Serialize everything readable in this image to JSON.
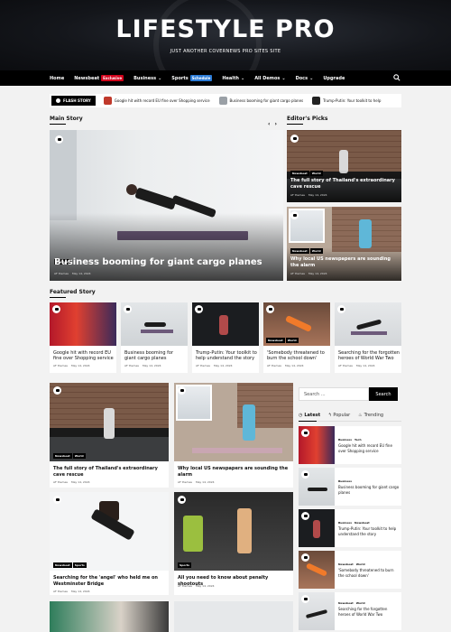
{
  "site": {
    "title": "LIFESTYLE PRO",
    "tagline": "JUST ANOTHER COVERNEWS PRO SITES SITE"
  },
  "nav": {
    "items": [
      "Home",
      "Newsbeat",
      "Business",
      "Sports",
      "Health",
      "All Demos",
      "Docs",
      "Upgrade"
    ],
    "badges": {
      "newsbeat": "Exclusive",
      "sports": "Schedule"
    },
    "colors": {
      "exclusive": "#d0021b",
      "schedule": "#2b7bd6"
    }
  },
  "flash": {
    "label": "FLASH STORY",
    "items": [
      "Google hit with record EU fine over Shopping service",
      "Business booming for giant cargo planes",
      "Trump-Putin: Your toolkit to help"
    ]
  },
  "main_story": {
    "heading": "Main Story",
    "tag": "Business",
    "title": "Business booming for giant cargo planes",
    "author": "AF themes",
    "date": "May 14, 2024"
  },
  "editors_picks": {
    "heading": "Editor's Picks",
    "items": [
      {
        "tags": [
          "Newsbeat",
          "World"
        ],
        "title": "The full story of Thailand's extraordinary cave rescue",
        "author": "AF themes",
        "date": "May 14, 2024"
      },
      {
        "tags": [
          "Newsbeat",
          "World"
        ],
        "title": "Why local US newspapers are sounding the alarm",
        "author": "AF themes",
        "date": "May 14, 2024"
      }
    ]
  },
  "featured": {
    "heading": "Featured Story",
    "items": [
      {
        "title": "Google hit with record EU fine over Shopping service",
        "author": "AF themes",
        "date": "May 14, 2024"
      },
      {
        "title": "Business booming for giant cargo planes",
        "author": "AF themes",
        "date": "May 14, 2024"
      },
      {
        "title": "Trump-Putin: Your toolkit to help understand the story",
        "author": "AF themes",
        "date": "May 14, 2024"
      },
      {
        "tags": [
          "Newsbeat",
          "World"
        ],
        "title": "'Somebody threatened to burn the school down'",
        "author": "AF themes",
        "date": "May 14, 2024"
      },
      {
        "title": "Searching for the forgotten heroes of World War Two",
        "author": "AF themes",
        "date": "May 14, 2024"
      }
    ]
  },
  "grid": [
    {
      "tags": [
        "Newsbeat",
        "World"
      ],
      "title": "The full story of Thailand's extraordinary cave rescue",
      "author": "AF themes",
      "date": "May 14, 2024"
    },
    {
      "title": "Why local US newspapers are sounding the alarm",
      "author": "AF themes",
      "date": "May 14, 2024"
    },
    {
      "tags": [
        "Newsbeat",
        "Sports"
      ],
      "title": "Searching for the 'angel' who held me on Westminster Bridge",
      "author": "AF themes",
      "date": "May 14, 2024"
    },
    {
      "tags": [
        "Sports"
      ],
      "title": "All you need to know about penalty shootouts",
      "author": "AF themes",
      "date": "May 14, 2024"
    }
  ],
  "sidebar": {
    "search_placeholder": "Search ...",
    "search_button": "Search",
    "tabs": [
      "Latest",
      "Popular",
      "Trending"
    ],
    "items": [
      {
        "tags": [
          "Business",
          "Tech"
        ],
        "title": "Google hit with record EU fine over Shopping service"
      },
      {
        "tags": [
          "Business"
        ],
        "title": "Business booming for giant cargo planes"
      },
      {
        "tags": [
          "Business",
          "Newsbeat"
        ],
        "title": "Trump-Putin: Your toolkit to help understand the story"
      },
      {
        "tags": [
          "Newsbeat",
          "World"
        ],
        "title": "'Somebody threatened to burn the school down'"
      },
      {
        "tags": [
          "Newsbeat",
          "World"
        ],
        "title": "Searching for the forgotten heroes of World War Two"
      }
    ]
  }
}
